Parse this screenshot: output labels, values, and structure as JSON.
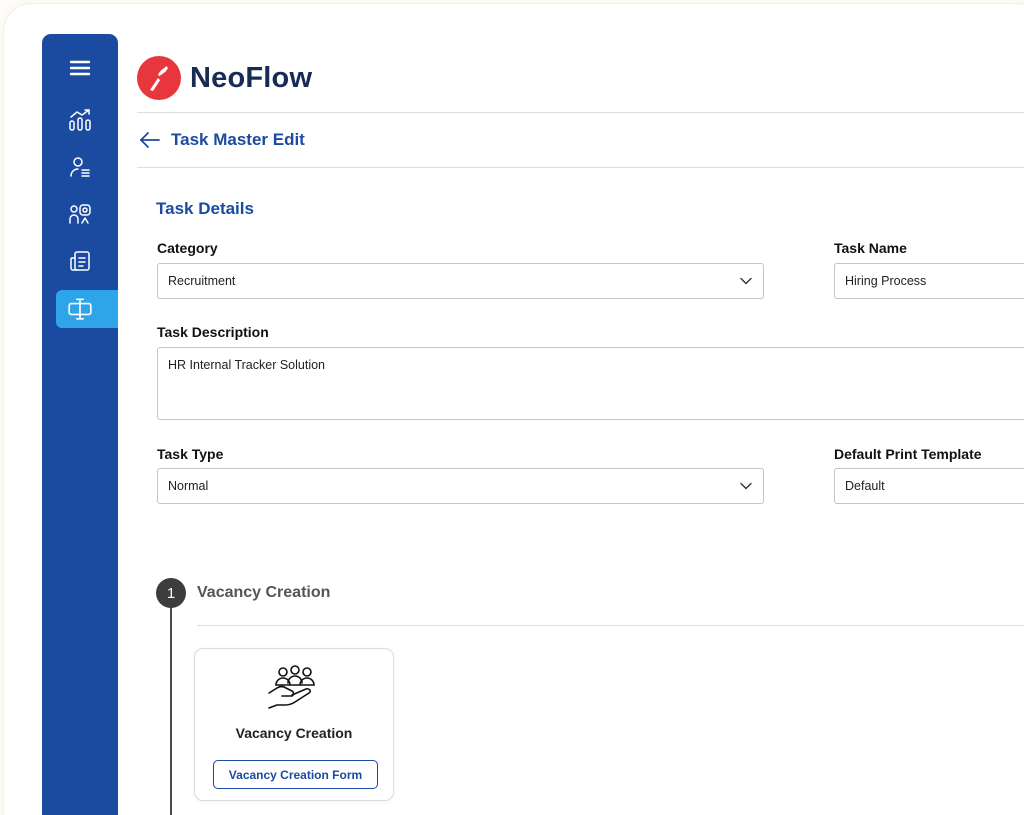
{
  "app": {
    "name": "NeoFlow",
    "brand_color": "#1b4ba0",
    "logo_color": "#e8363d",
    "accent": "#2ea5e8"
  },
  "sidebar": {
    "items": [
      {
        "icon": "menu-icon",
        "active": false
      },
      {
        "icon": "analytics-icon",
        "active": false
      },
      {
        "icon": "user-list-icon",
        "active": false
      },
      {
        "icon": "people-chat-icon",
        "active": false
      },
      {
        "icon": "document-list-icon",
        "active": false
      },
      {
        "icon": "task-master-icon",
        "active": true
      }
    ]
  },
  "header": {
    "title": "Task Master Edit"
  },
  "form": {
    "section_title": "Task Details",
    "category": {
      "label": "Category",
      "value": "Recruitment"
    },
    "task_name": {
      "label": "Task Name",
      "value": "Hiring Process"
    },
    "task_description": {
      "label": "Task Description",
      "value": "HR Internal Tracker Solution"
    },
    "task_type": {
      "label": "Task Type",
      "value": "Normal"
    },
    "default_print_template": {
      "label": "Default Print Template",
      "value": "Default"
    }
  },
  "steps": [
    {
      "number": "1",
      "title": "Vacancy Creation",
      "card": {
        "icon": "hand-holding-people-icon",
        "title": "Vacancy Creation",
        "button_label": "Vacancy Creation Form"
      }
    }
  ]
}
